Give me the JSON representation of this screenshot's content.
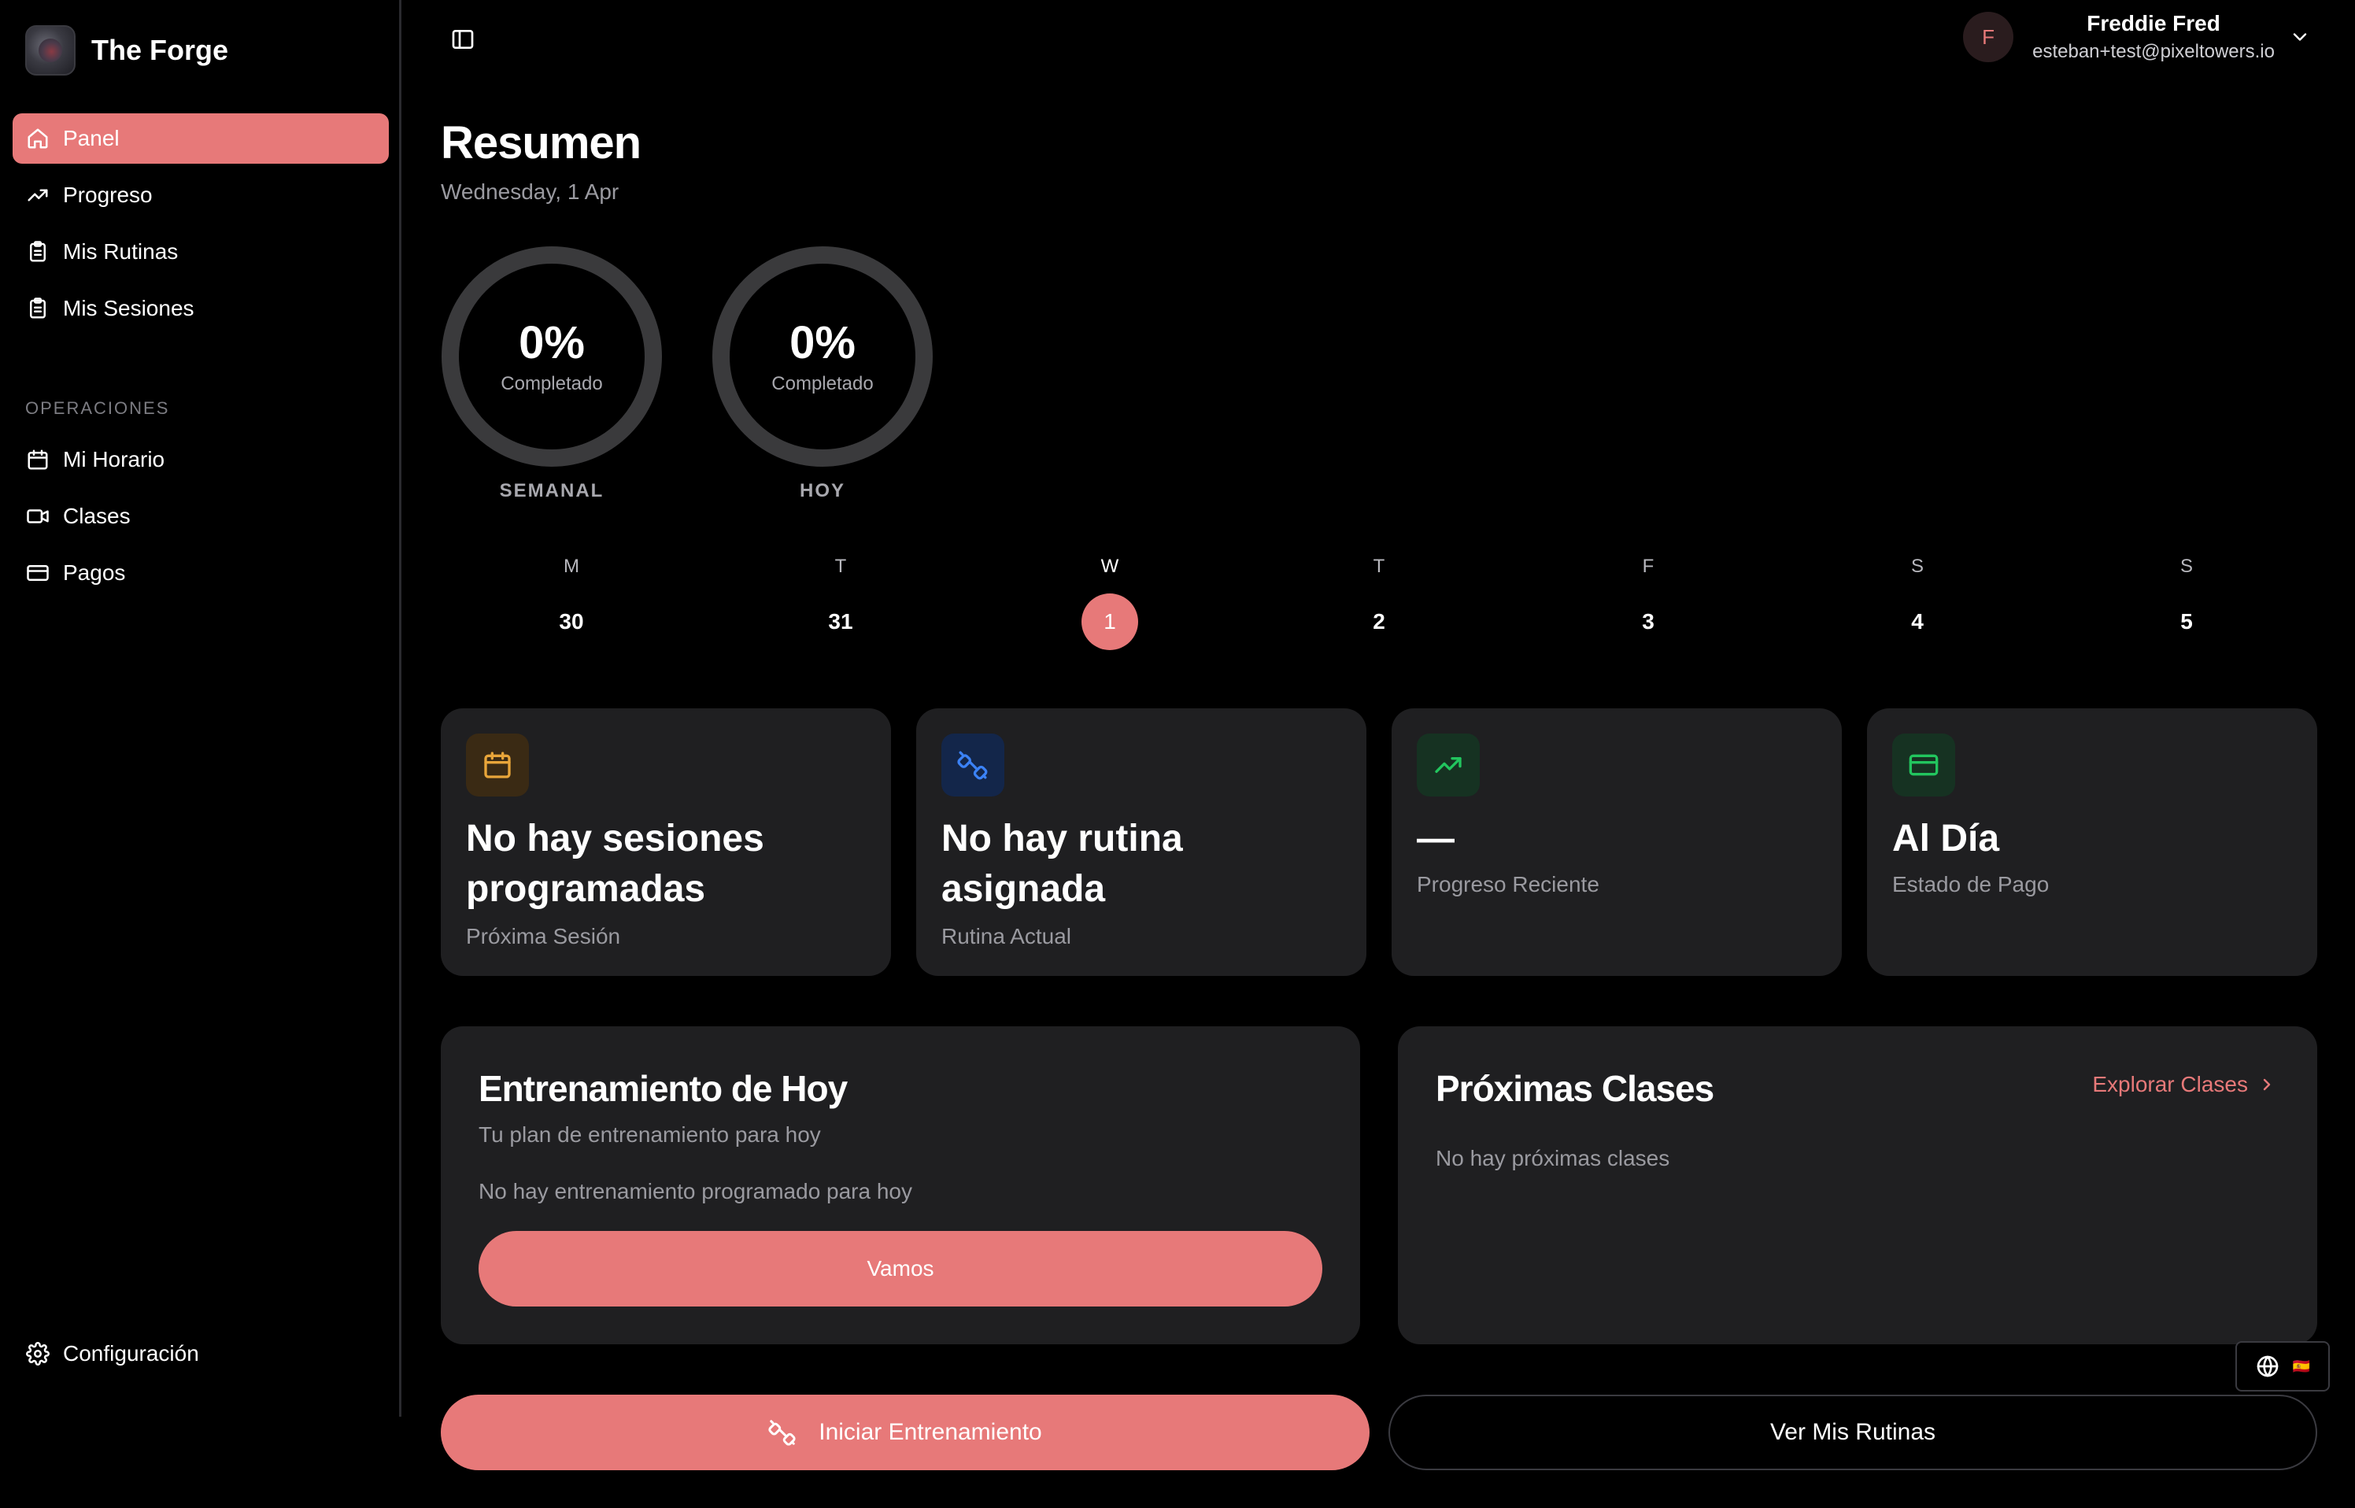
{
  "app": {
    "name": "The Forge"
  },
  "sidebar": {
    "items": [
      {
        "label": "Panel",
        "icon": "home-icon",
        "active": true
      },
      {
        "label": "Progreso",
        "icon": "trending-up-icon"
      },
      {
        "label": "Mis Rutinas",
        "icon": "clipboard-icon"
      },
      {
        "label": "Mis Sesiones",
        "icon": "clipboard-icon"
      }
    ],
    "section_label": "OPERACIONES",
    "ops_items": [
      {
        "label": "Mi Horario",
        "icon": "calendar-icon"
      },
      {
        "label": "Clases",
        "icon": "video-icon"
      },
      {
        "label": "Pagos",
        "icon": "credit-card-icon"
      }
    ],
    "settings_label": "Configuración"
  },
  "user": {
    "initial": "F",
    "name": "Freddie Fred",
    "email": "esteban+test@pixeltowers.io"
  },
  "main": {
    "title": "Resumen",
    "date": "Wednesday, 1 Apr"
  },
  "progress": {
    "weekly": {
      "value": "0%",
      "sub": "Completado",
      "label": "SEMANAL",
      "fraction": 0
    },
    "today": {
      "value": "0%",
      "sub": "Completado",
      "label": "HOY",
      "fraction": 0
    }
  },
  "week": {
    "days": [
      {
        "name": "M",
        "date": "30"
      },
      {
        "name": "T",
        "date": "31"
      },
      {
        "name": "W",
        "date": "1",
        "today": true
      },
      {
        "name": "T",
        "date": "2"
      },
      {
        "name": "F",
        "date": "3"
      },
      {
        "name": "S",
        "date": "4"
      },
      {
        "name": "S",
        "date": "5"
      }
    ]
  },
  "stats": [
    {
      "value": "No hay sesiones programadas",
      "label": "Próxima Sesión",
      "icon": "calendar-icon",
      "color": "#e8a53a"
    },
    {
      "value": "No hay rutina asignada",
      "label": "Rutina Actual",
      "icon": "dumbbell-icon",
      "color": "#3b82f6"
    },
    {
      "value": "—",
      "label": "Progreso Reciente",
      "icon": "trending-up-icon",
      "color": "#22c55e"
    },
    {
      "value": "Al Día",
      "label": "Estado de Pago",
      "icon": "credit-card-icon",
      "color": "#22c55e"
    }
  ],
  "today_workout": {
    "title": "Entrenamiento de Hoy",
    "subtitle": "Tu plan de entrenamiento para hoy",
    "empty": "No hay entrenamiento programado para hoy",
    "button": "Vamos"
  },
  "upcoming_classes": {
    "title": "Próximas Clases",
    "link": "Explorar Clases",
    "empty": "No hay próximas clases"
  },
  "actions": {
    "start": "Iniciar Entrenamiento",
    "routines": "Ver Mis Rutinas"
  },
  "language": {
    "flag": "🇪🇸"
  },
  "colors": {
    "accent": "#e77979",
    "card": "#1f1f21",
    "background": "#000000"
  }
}
